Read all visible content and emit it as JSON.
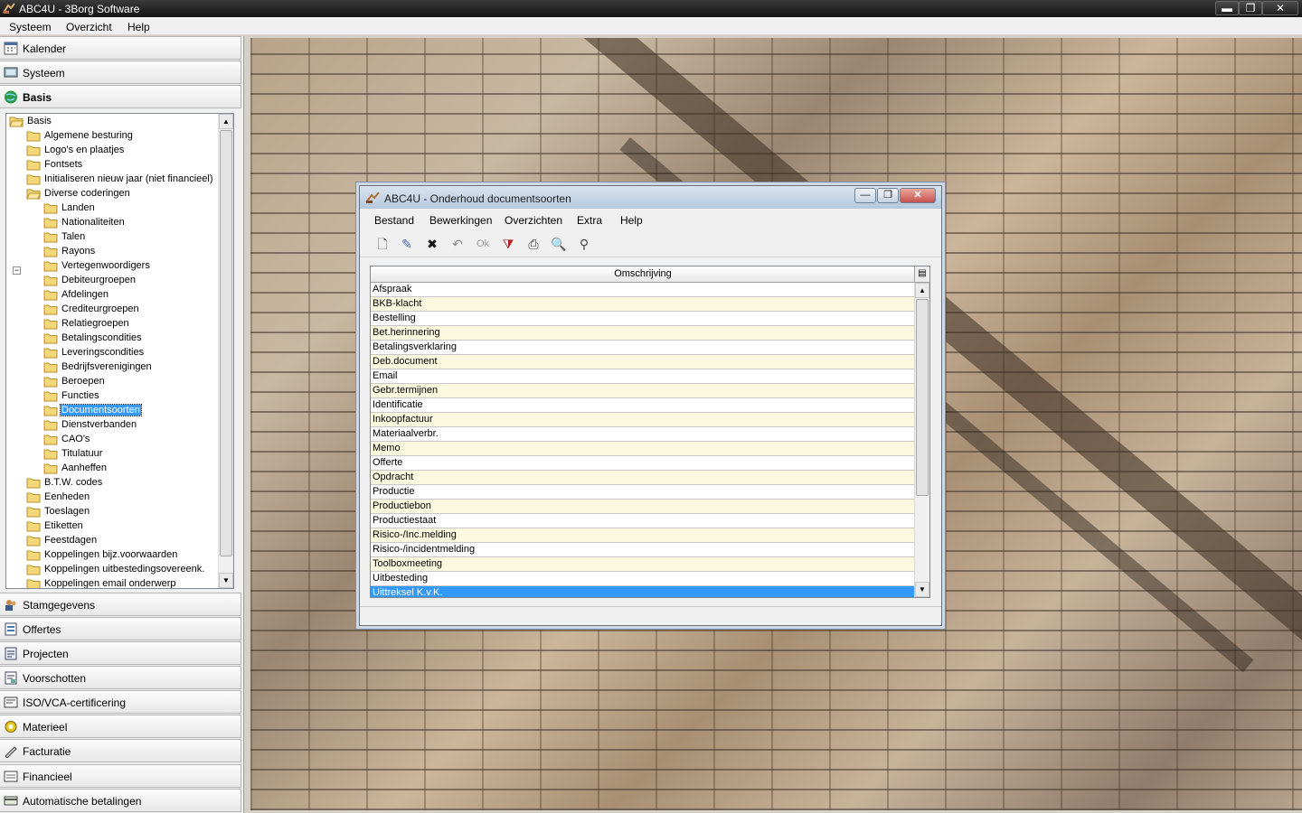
{
  "window": {
    "title": "ABC4U - 3Borg Software",
    "controls": {
      "minimize": "▬",
      "restore": "❐",
      "close": "✕"
    }
  },
  "menubar": [
    "Systeem",
    "Overzicht",
    "Help"
  ],
  "nav_top": [
    {
      "label": "Kalender",
      "icon": "calendar-icon"
    },
    {
      "label": "Systeem",
      "icon": "system-icon"
    },
    {
      "label": "Basis",
      "icon": "globe-icon"
    }
  ],
  "tree": {
    "root": "Basis",
    "items": [
      "Algemene besturing",
      "Logo's en plaatjes",
      "Fontsets",
      "Initialiseren nieuw jaar (niet financieel)",
      "Diverse coderingen"
    ],
    "sub_items": [
      "Landen",
      "Nationaliteiten",
      "Talen",
      "Rayons",
      "Vertegenwoordigers",
      "Debiteurgroepen",
      "Afdelingen",
      "Crediteurgroepen",
      "Relatiegroepen",
      "Betalingscondities",
      "Leveringscondities",
      "Bedrijfsverenigingen",
      "Beroepen",
      "Functies",
      "Documentsoorten",
      "Dienstverbanden",
      "CAO's",
      "Titulatuur",
      "Aanheffen"
    ],
    "selected": "Documentsoorten",
    "after_items": [
      "B.T.W. codes",
      "Eenheden",
      "Toeslagen",
      "Etiketten",
      "Feestdagen",
      "Koppelingen bijz.voorwaarden",
      "Koppelingen uitbestedingsovereenk.",
      "Koppelingen email onderwerp"
    ],
    "expander": "−"
  },
  "nav_bottom": [
    {
      "label": "Stamgegevens",
      "icon": "people-icon"
    },
    {
      "label": "Offertes",
      "icon": "offer-icon"
    },
    {
      "label": "Projecten",
      "icon": "project-icon"
    },
    {
      "label": "Voorschotten",
      "icon": "advance-icon"
    },
    {
      "label": "ISO/VCA-certificering",
      "icon": "certificate-icon"
    },
    {
      "label": "Materieel",
      "icon": "gear-icon"
    },
    {
      "label": "Facturatie",
      "icon": "pen-icon"
    },
    {
      "label": "Financieel",
      "icon": "finance-icon"
    },
    {
      "label": "Automatische betalingen",
      "icon": "payment-icon"
    }
  ],
  "dialog": {
    "title": "ABC4U - Onderhoud documentsoorten",
    "controls": {
      "minimize": "—",
      "restore": "❐",
      "close": "✕"
    },
    "menu": [
      "Bestand",
      "Bewerkingen",
      "Overzichten",
      "Extra",
      "Help"
    ],
    "toolbar": [
      {
        "name": "new-icon",
        "glyph": "🗋"
      },
      {
        "name": "edit-icon",
        "glyph": "✎"
      },
      {
        "name": "delete-icon",
        "glyph": "✖"
      },
      {
        "name": "undo-icon",
        "glyph": "↶"
      },
      {
        "name": "ok-icon",
        "glyph": "Ok"
      },
      {
        "name": "filter-icon",
        "glyph": "⧩"
      },
      {
        "name": "print-icon",
        "glyph": "⎙"
      },
      {
        "name": "preview-icon",
        "glyph": "🔍"
      },
      {
        "name": "find-icon",
        "glyph": "⚲"
      }
    ],
    "grid": {
      "header": "Omschrijving",
      "rows": [
        "Afspraak",
        "BKB-klacht",
        "Bestelling",
        "Bet.herinnering",
        "Betalingsverklaring",
        "Deb.document",
        "Email",
        "Gebr.termijnen",
        "Identificatie",
        "Inkoopfactuur",
        "Materiaalverbr.",
        "Memo",
        "Offerte",
        "Opdracht",
        "Productie",
        "Productiebon",
        "Productiestaat",
        "Risico-/Inc.melding",
        "Risico-/incidentmelding",
        "Toolboxmeeting",
        "Uitbesteding",
        "Uittreksel K.v.K."
      ],
      "selected": "Uittreksel K.v.K."
    }
  },
  "scroll": {
    "up": "▲",
    "down": "▼"
  }
}
